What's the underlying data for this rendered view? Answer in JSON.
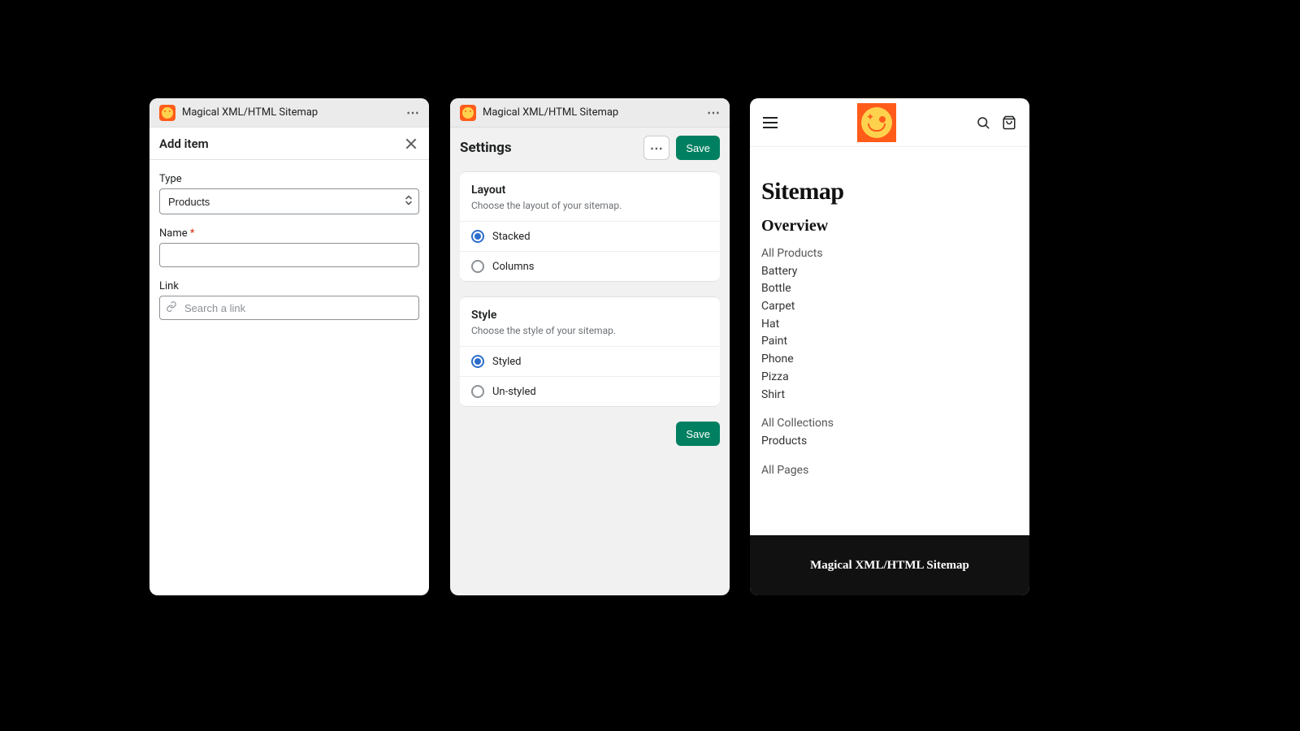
{
  "panel1": {
    "app_name": "Magical XML/HTML Sitemap",
    "title": "Add item",
    "type_label": "Type",
    "type_value": "Products",
    "name_label": "Name",
    "link_label": "Link",
    "link_placeholder": "Search a link"
  },
  "panel2": {
    "app_name": "Magical XML/HTML Sitemap",
    "title": "Settings",
    "save": "Save",
    "layout": {
      "heading": "Layout",
      "desc": "Choose the layout of your sitemap.",
      "opt1": "Stacked",
      "opt2": "Columns",
      "selected": "Stacked"
    },
    "style": {
      "heading": "Style",
      "desc": "Choose the style of your sitemap.",
      "opt1": "Styled",
      "opt2": "Un-styled",
      "selected": "Styled"
    },
    "footer_save": "Save"
  },
  "panel3": {
    "title": "Sitemap",
    "section": "Overview",
    "products_head": "All Products",
    "products": [
      "Battery",
      "Bottle",
      "Carpet",
      "Hat",
      "Paint",
      "Phone",
      "Pizza",
      "Shirt"
    ],
    "collections_head": "All Collections",
    "collections": [
      "Products"
    ],
    "pages_head": "All Pages",
    "footer": "Magical XML/HTML Sitemap"
  }
}
